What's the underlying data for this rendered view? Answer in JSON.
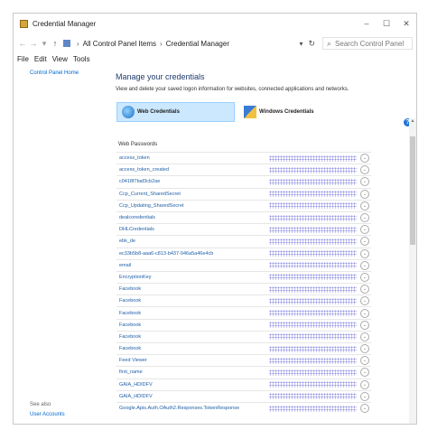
{
  "window": {
    "title": "Credential Manager",
    "buttons": {
      "minimize": "–",
      "maximize": "☐",
      "close": "✕"
    }
  },
  "address": {
    "back": "←",
    "forward": "→",
    "up": "↑",
    "dropdown_caret": "▾",
    "crumbs": [
      "All Control Panel Items",
      "Credential Manager"
    ],
    "separator": "›",
    "refresh": "↻",
    "search_placeholder": "Search Control Panel"
  },
  "menu": {
    "items": [
      "File",
      "Edit",
      "View",
      "Tools"
    ]
  },
  "leftnav": {
    "home": "Control Panel Home",
    "see_also": "See also",
    "user_accounts": "User Accounts"
  },
  "main": {
    "heading": "Manage your credentials",
    "subtitle": "View and delete your saved logon information for websites, connected applications and networks.",
    "tiles": {
      "web": "Web Credentials",
      "windows": "Windows Credentials"
    },
    "list_label": "Web Passwords",
    "rows": [
      "access_token",
      "access_token_created",
      "c0418f7baf3cb2ae",
      "Ccp_Current_SharedSecret",
      "Ccp_Updating_SharedSecret",
      "dealcoredentials",
      "DHLCredentials",
      "ebk_de",
      "ec33b5b8-aaa6-c813-b437-946a5a46e4cb",
      "email",
      "EncryptionKey",
      "Facebook",
      "Facebook",
      "Facebook",
      "Facebook",
      "Facebook",
      "Facebook",
      "Feed Viewer",
      "first_name",
      "GAIA_HDIDFV",
      "GAIA_HDIDFV",
      "Google.Apis.Auth.OAuth2.Responses.TokenResponse"
    ]
  },
  "icons": {
    "help": "?",
    "expand": "⌄"
  }
}
